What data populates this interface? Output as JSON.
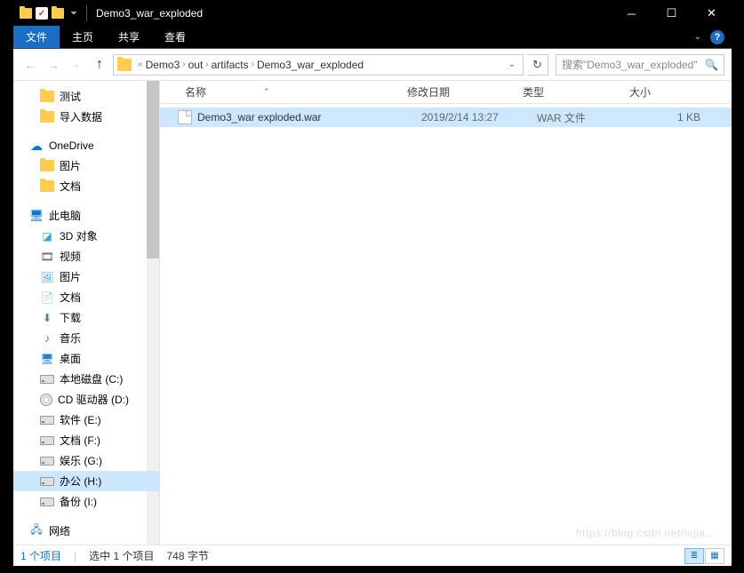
{
  "titlebar": {
    "title": "Demo3_war_exploded"
  },
  "ribbon": {
    "file": "文件",
    "home": "主页",
    "share": "共享",
    "view": "查看"
  },
  "breadcrumb": {
    "items": [
      "Demo3",
      "out",
      "artifacts",
      "Demo3_war_exploded"
    ]
  },
  "search": {
    "placeholder": "搜索\"Demo3_war_exploded\""
  },
  "nav": {
    "quick": {
      "test": "测试",
      "import": "导入数据"
    },
    "onedrive": {
      "label": "OneDrive",
      "pictures": "图片",
      "docs": "文档"
    },
    "thispc": {
      "label": "此电脑",
      "objects3d": "3D 对象",
      "videos": "视频",
      "pictures": "图片",
      "docs": "文档",
      "downloads": "下载",
      "music": "音乐",
      "desktop": "桌面",
      "local_c": "本地磁盘 (C:)",
      "cd_d": "CD 驱动器 (D:)",
      "soft_e": "软件 (E:)",
      "docs_f": "文档 (F:)",
      "ent_g": "娱乐 (G:)",
      "office_h": "办公 (H:)",
      "backup_i": "备份 (I:)"
    },
    "network": "网络"
  },
  "columns": {
    "name": "名称",
    "date": "修改日期",
    "type": "类型",
    "size": "大小"
  },
  "files": [
    {
      "name": "Demo3_war exploded.war",
      "date": "2019/2/14 13:27",
      "type": "WAR 文件",
      "size": "1 KB"
    }
  ],
  "status": {
    "count": "1 个项目",
    "selected": "选中 1 个项目",
    "bytes": "748 字节"
  },
  "watermark": "https://blog.csdn.net/lujia..."
}
